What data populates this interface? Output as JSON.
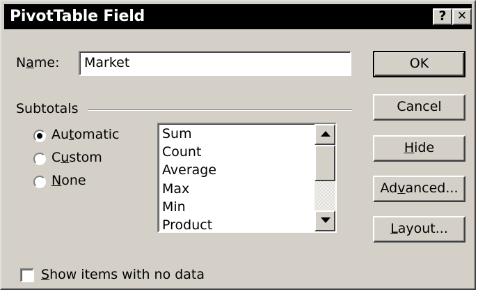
{
  "window": {
    "title": "PivotTable Field",
    "help_label": "?",
    "close_label": "✕"
  },
  "name_field": {
    "label_pre": "N",
    "label_accel": "a",
    "label_post": "me:",
    "value": "Market"
  },
  "subtotals": {
    "title": "Subtotals",
    "options": [
      {
        "pre": "Au",
        "accel": "t",
        "post": "omatic",
        "selected": true
      },
      {
        "pre": "C",
        "accel": "u",
        "post": "stom",
        "selected": false
      },
      {
        "pre": "",
        "accel": "N",
        "post": "one",
        "selected": false
      }
    ],
    "functions": [
      "Sum",
      "Count",
      "Average",
      "Max",
      "Min",
      "Product"
    ]
  },
  "buttons": {
    "ok": "OK",
    "cancel": "Cancel",
    "hide": {
      "pre": "",
      "accel": "H",
      "post": "ide"
    },
    "advanced": {
      "pre": "Ad",
      "accel": "v",
      "post": "anced..."
    },
    "layout": {
      "pre": "",
      "accel": "L",
      "post": "ayout..."
    }
  },
  "show_items": {
    "pre": "",
    "accel": "S",
    "post": "how items with no data",
    "checked": false
  }
}
